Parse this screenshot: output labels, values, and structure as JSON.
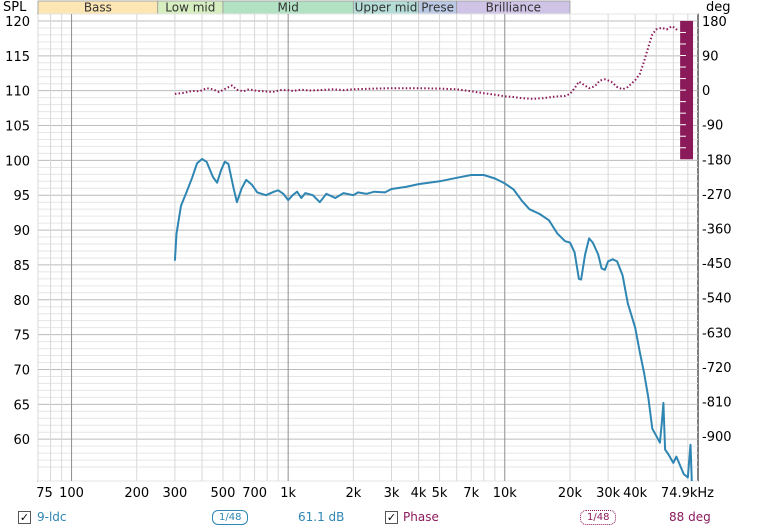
{
  "chart_data": {
    "type": "line",
    "y_axis_left": {
      "label": "SPL",
      "range": [
        54,
        121
      ],
      "ticks": [
        120,
        115,
        110,
        105,
        100,
        95,
        90,
        85,
        80,
        75,
        70,
        65,
        60
      ]
    },
    "y_axis_right": {
      "label": "deg",
      "range": [
        -1017,
        198
      ],
      "ticks": [
        180,
        90,
        0,
        -90,
        -180,
        -270,
        -360,
        -450,
        -540,
        -630,
        -720,
        -810,
        -900
      ]
    },
    "x_axis": {
      "scale": "log",
      "range": [
        70,
        78000
      ],
      "ticks": [
        {
          "v": 75,
          "t": "75"
        },
        {
          "v": 100,
          "t": "100"
        },
        {
          "v": 200,
          "t": "200"
        },
        {
          "v": 300,
          "t": "300"
        },
        {
          "v": 500,
          "t": "500"
        },
        {
          "v": 700,
          "t": "700"
        },
        {
          "v": 1000,
          "t": "1k"
        },
        {
          "v": 2000,
          "t": "2k"
        },
        {
          "v": 3000,
          "t": "3k"
        },
        {
          "v": 4000,
          "t": "4k"
        },
        {
          "v": 5000,
          "t": "5k"
        },
        {
          "v": 7000,
          "t": "7k"
        },
        {
          "v": 10000,
          "t": "10k"
        },
        {
          "v": 20000,
          "t": "20k"
        },
        {
          "v": 30000,
          "t": "30k"
        },
        {
          "v": 40000,
          "t": "40k"
        },
        {
          "v": 74900,
          "t": "74.9kHz"
        }
      ]
    },
    "bands": [
      {
        "label": "Bass",
        "from": 70,
        "to": 250,
        "color": "#fbe6b4"
      },
      {
        "label": "Low mid",
        "from": 250,
        "to": 500,
        "color": "#d7eec1"
      },
      {
        "label": "Mid",
        "from": 500,
        "to": 2000,
        "color": "#b2e2c3"
      },
      {
        "label": "Upper mid",
        "from": 2000,
        "to": 4000,
        "color": "#b5ddd8"
      },
      {
        "label": "Prese",
        "from": 4000,
        "to": 6000,
        "color": "#bcc9e5"
      },
      {
        "label": "Brilliance",
        "from": 6000,
        "to": 20000,
        "color": "#cfc3e6"
      }
    ],
    "series": [
      {
        "name": "9-ldc",
        "color": "#2f86b2",
        "axis": "left",
        "style": "solid",
        "points": [
          [
            300,
            85.6
          ],
          [
            305,
            89.5
          ],
          [
            320,
            93.5
          ],
          [
            340,
            95.5
          ],
          [
            360,
            97.5
          ],
          [
            380,
            99.6
          ],
          [
            400,
            100.2
          ],
          [
            420,
            99.8
          ],
          [
            450,
            97.6
          ],
          [
            470,
            96.8
          ],
          [
            490,
            98.6
          ],
          [
            510,
            99.8
          ],
          [
            530,
            99.5
          ],
          [
            560,
            96.0
          ],
          [
            580,
            94.0
          ],
          [
            610,
            96.0
          ],
          [
            640,
            97.2
          ],
          [
            680,
            96.5
          ],
          [
            720,
            95.4
          ],
          [
            790,
            95.0
          ],
          [
            860,
            95.5
          ],
          [
            900,
            95.7
          ],
          [
            950,
            95.2
          ],
          [
            1000,
            94.3
          ],
          [
            1050,
            95.0
          ],
          [
            1100,
            95.5
          ],
          [
            1150,
            94.6
          ],
          [
            1200,
            95.3
          ],
          [
            1300,
            95.0
          ],
          [
            1400,
            94.0
          ],
          [
            1500,
            95.2
          ],
          [
            1650,
            94.6
          ],
          [
            1800,
            95.3
          ],
          [
            2000,
            95.0
          ],
          [
            2100,
            95.4
          ],
          [
            2300,
            95.2
          ],
          [
            2500,
            95.5
          ],
          [
            2800,
            95.4
          ],
          [
            3000,
            95.9
          ],
          [
            3500,
            96.2
          ],
          [
            4000,
            96.6
          ],
          [
            5000,
            97.0
          ],
          [
            6000,
            97.5
          ],
          [
            7000,
            97.9
          ],
          [
            8000,
            97.9
          ],
          [
            9000,
            97.4
          ],
          [
            10000,
            96.7
          ],
          [
            11000,
            95.8
          ],
          [
            12000,
            94.2
          ],
          [
            13000,
            93.0
          ],
          [
            14500,
            92.3
          ],
          [
            16000,
            91.4
          ],
          [
            17500,
            89.5
          ],
          [
            19000,
            88.4
          ],
          [
            20000,
            88.2
          ],
          [
            21000,
            86.8
          ],
          [
            22000,
            83.0
          ],
          [
            22500,
            82.9
          ],
          [
            23500,
            86.5
          ],
          [
            24500,
            88.8
          ],
          [
            25500,
            88.2
          ],
          [
            27000,
            86.5
          ],
          [
            28000,
            84.5
          ],
          [
            29000,
            84.3
          ],
          [
            30000,
            85.5
          ],
          [
            31500,
            85.8
          ],
          [
            33000,
            85.5
          ],
          [
            35000,
            83.5
          ],
          [
            37000,
            79.5
          ],
          [
            40000,
            76.0
          ],
          [
            42000,
            72.5
          ],
          [
            44000,
            69.5
          ],
          [
            46000,
            66.0
          ],
          [
            48000,
            61.5
          ],
          [
            50000,
            60.5
          ],
          [
            52000,
            59.5
          ],
          [
            53000,
            62.0
          ],
          [
            54000,
            65.2
          ],
          [
            55000,
            58.5
          ],
          [
            57000,
            57.8
          ],
          [
            60000,
            56.6
          ],
          [
            62000,
            57.5
          ],
          [
            65000,
            56.0
          ],
          [
            67000,
            55.0
          ],
          [
            70000,
            54.5
          ],
          [
            72000,
            59.2
          ],
          [
            73000,
            54.0
          ]
        ]
      },
      {
        "name": "Phase",
        "color": "#8b1a5a",
        "axis": "right",
        "style": "dotted",
        "points": [
          [
            300,
            -10
          ],
          [
            330,
            -7
          ],
          [
            360,
            -2
          ],
          [
            390,
            -3
          ],
          [
            420,
            5
          ],
          [
            450,
            2
          ],
          [
            480,
            -5
          ],
          [
            510,
            3
          ],
          [
            550,
            12
          ],
          [
            580,
            1
          ],
          [
            620,
            -3
          ],
          [
            660,
            2
          ],
          [
            720,
            -2
          ],
          [
            780,
            -3
          ],
          [
            850,
            -5
          ],
          [
            920,
            0
          ],
          [
            1000,
            0
          ],
          [
            1050,
            -2
          ],
          [
            1150,
            1
          ],
          [
            1250,
            -1
          ],
          [
            1400,
            0
          ],
          [
            1600,
            2
          ],
          [
            1800,
            0
          ],
          [
            2000,
            2
          ],
          [
            2500,
            4
          ],
          [
            3000,
            5
          ],
          [
            4000,
            5
          ],
          [
            5000,
            4
          ],
          [
            6000,
            2
          ],
          [
            7000,
            -3
          ],
          [
            8000,
            -8
          ],
          [
            9000,
            -12
          ],
          [
            10000,
            -16
          ],
          [
            11000,
            -18
          ],
          [
            12000,
            -21
          ],
          [
            13500,
            -23
          ],
          [
            15000,
            -21
          ],
          [
            17000,
            -17
          ],
          [
            19000,
            -15
          ],
          [
            20000,
            -10
          ],
          [
            21000,
            5
          ],
          [
            22000,
            22
          ],
          [
            23000,
            15
          ],
          [
            24500,
            5
          ],
          [
            26000,
            10
          ],
          [
            27500,
            25
          ],
          [
            29000,
            28
          ],
          [
            31000,
            22
          ],
          [
            33000,
            8
          ],
          [
            35000,
            2
          ],
          [
            37000,
            8
          ],
          [
            40000,
            26
          ],
          [
            42000,
            42
          ],
          [
            44000,
            75
          ],
          [
            46000,
            112
          ],
          [
            48000,
            145
          ],
          [
            50000,
            158
          ],
          [
            53000,
            162
          ],
          [
            56000,
            158
          ],
          [
            59000,
            166
          ],
          [
            61000,
            162
          ],
          [
            63000,
            154
          ]
        ]
      }
    ],
    "legend": {
      "items": [
        {
          "checked": true,
          "name": "9-ldc",
          "smoothing": "1/48",
          "readout": "61.1 dB",
          "color": "#2f86b2"
        },
        {
          "checked": true,
          "name": "Phase",
          "smoothing": "1/48",
          "readout": "88 deg",
          "color": "#8b1a5a"
        }
      ]
    }
  }
}
